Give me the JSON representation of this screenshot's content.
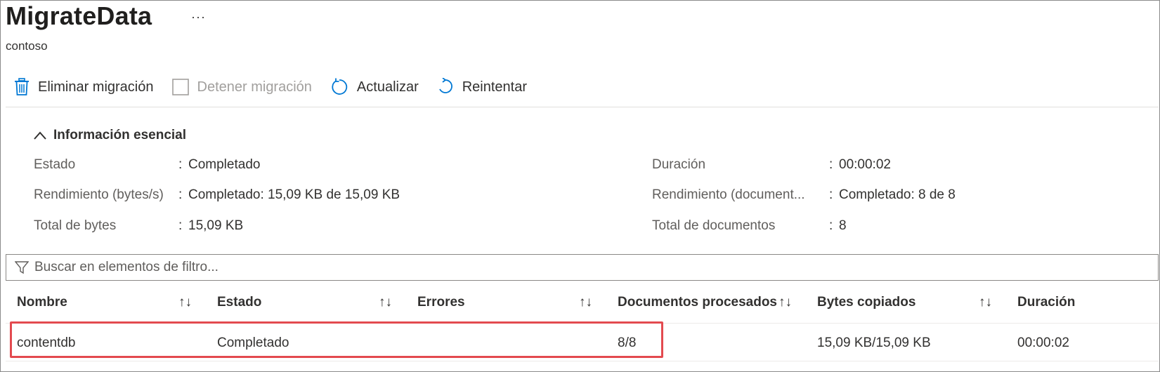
{
  "header": {
    "title": "MigrateData",
    "more": "···",
    "subtitle": "contoso"
  },
  "toolbar": {
    "delete_label": "Eliminar migración",
    "stop_label": "Detener migración",
    "refresh_label": "Actualizar",
    "retry_label": "Reintentar"
  },
  "essentials": {
    "header": "Información esencial",
    "separator": ":",
    "left": [
      {
        "key": "Estado",
        "value": "Completado"
      },
      {
        "key": "Rendimiento (bytes/s)",
        "value": "Completado: 15,09 KB de 15,09 KB"
      },
      {
        "key": "Total de bytes",
        "value": "15,09 KB"
      }
    ],
    "right": [
      {
        "key": "Duración",
        "value": "00:00:02"
      },
      {
        "key": "Rendimiento (document...",
        "value": "Completado: 8 de 8"
      },
      {
        "key": "Total de documentos",
        "value": "8"
      }
    ]
  },
  "filter": {
    "placeholder": "Buscar en elementos de filtro..."
  },
  "table": {
    "sort_glyph": "↑↓",
    "columns": [
      "Nombre",
      "Estado",
      "Errores",
      "Documentos procesados",
      "Bytes copiados",
      "Duración"
    ],
    "rows": [
      {
        "nombre": "contentdb",
        "estado": "Completado",
        "errores": "",
        "documentos": "8/8",
        "bytes": "15,09 KB/15,09 KB",
        "duracion": "00:00:02"
      }
    ]
  },
  "colors": {
    "accent": "#0078d4",
    "highlight": "#e34a4f"
  }
}
